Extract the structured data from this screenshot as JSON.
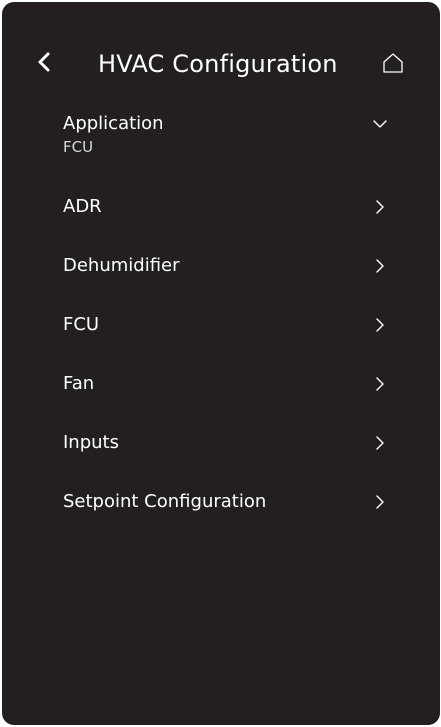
{
  "header": {
    "title": "HVAC Configuration",
    "back_icon": "chevron-left-icon",
    "home_icon": "home-icon"
  },
  "menu": {
    "application": {
      "label": "Application",
      "value": "FCU",
      "icon": "chevron-down-icon"
    },
    "items": [
      {
        "label": "ADR",
        "icon": "chevron-right-icon"
      },
      {
        "label": "Dehumidifier",
        "icon": "chevron-right-icon"
      },
      {
        "label": "FCU",
        "icon": "chevron-right-icon"
      },
      {
        "label": "Fan",
        "icon": "chevron-right-icon"
      },
      {
        "label": "Inputs",
        "icon": "chevron-right-icon"
      },
      {
        "label": "Setpoint Configuration",
        "icon": "chevron-right-icon"
      }
    ]
  },
  "colors": {
    "background": "#231f20",
    "text": "#ffffff",
    "subtext": "#d9d9d9"
  }
}
